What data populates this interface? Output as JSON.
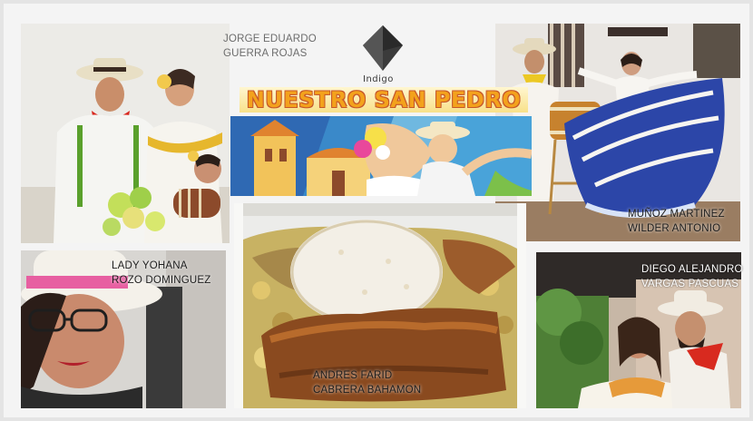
{
  "logo": {
    "brand": "Indigo",
    "icon": "diamond-logo-icon"
  },
  "banner": {
    "title": "NUESTRO SAN PEDRO"
  },
  "people": [
    {
      "line1": "JORGE EDUARDO",
      "line2": "GUERRA ROJAS"
    },
    {
      "line1": "MUÑOZ MARTINEZ",
      "line2": "WILDER ANTONIO"
    },
    {
      "line1": "LADY YOHANA",
      "line2": "ROZO DOMINGUEZ"
    },
    {
      "line1": "ANDRES FARID",
      "line2": "CABRERA BAHAMON"
    },
    {
      "line1": "DIEGO ALEJANDRO",
      "line2": "VARGAS PASCUAS"
    }
  ],
  "colors": {
    "banner_orange": "#f3a21c",
    "banner_outline": "#c6562b",
    "dress_blue": "#2c46a8",
    "scarf_red": "#d82a1f"
  }
}
